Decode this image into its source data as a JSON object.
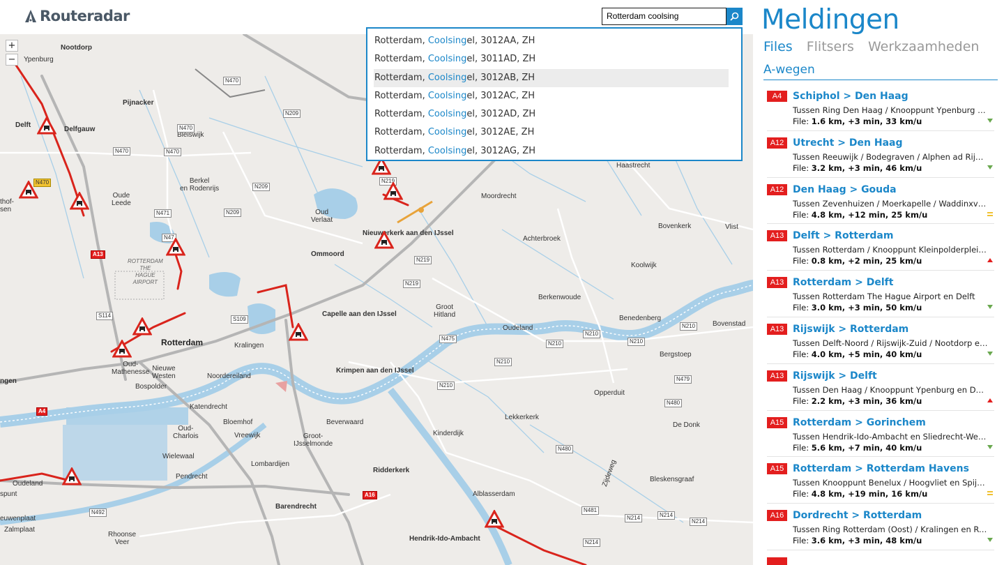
{
  "app": {
    "logo_text": "Routeradar"
  },
  "search": {
    "value": "Rotterdam coolsing",
    "button_icon": "search-icon"
  },
  "autocomplete": {
    "items": [
      {
        "prefix": "Rotterdam, ",
        "highlight": "Coolsing",
        "suffix": "el, 3012AA, ZH",
        "selected": false
      },
      {
        "prefix": "Rotterdam, ",
        "highlight": "Coolsing",
        "suffix": "el, 3011AD, ZH",
        "selected": false
      },
      {
        "prefix": "Rotterdam, ",
        "highlight": "Coolsing",
        "suffix": "el, 3012AB, ZH",
        "selected": true
      },
      {
        "prefix": "Rotterdam, ",
        "highlight": "Coolsing",
        "suffix": "el, 3012AC, ZH",
        "selected": false
      },
      {
        "prefix": "Rotterdam, ",
        "highlight": "Coolsing",
        "suffix": "el, 3012AD, ZH",
        "selected": false
      },
      {
        "prefix": "Rotterdam, ",
        "highlight": "Coolsing",
        "suffix": "el, 3012AE, ZH",
        "selected": false
      },
      {
        "prefix": "Rotterdam, ",
        "highlight": "Coolsing",
        "suffix": "el, 3012AG, ZH",
        "selected": false
      }
    ]
  },
  "map": {
    "zoom_in": "+",
    "zoom_out": "−",
    "labels": {
      "nootdorp": "Nootdorp",
      "ypenburg": "Ypenburg",
      "pijnacker": "Pijnacker",
      "delft": "Delft",
      "delfgauw": "Delfgauw",
      "bleiswijk": "Bleiswijk",
      "berkel": "Berkel\nen Rodenrijs",
      "oude_leede": "Oude\nLeede",
      "ommoord": "Ommoord",
      "nieuwerkerk": "Nieuwerkerk aan den IJssel",
      "oud_verlaat": "Oud\nVerlaat",
      "moordrecht": "Moordrecht",
      "achterbroek": "Achterbroek",
      "bovenkerk": "Bovenkerk",
      "vlist": "Vlist",
      "koolwijk": "Koolwijk",
      "berkenwoude": "Berkenwoude",
      "benedenberg": "Benedenberg",
      "bovenstad": "Bovenstad",
      "rotterdam_airport": "ROTTERDAM\nTHE\nHAGUE\nAIRPORT",
      "capelle": "Capelle aan den IJssel",
      "groot_hitland": "Groot\nHitland",
      "oudeland": "Oudeland",
      "bergstoep": "Bergstoep",
      "rotterdam": "Rotterdam",
      "kralingen": "Kralingen",
      "oud_mathenesse": "Oud-\nMathenesse",
      "nieuwe_westen": "Nieuwe\nWesten",
      "noordereiland": "Noordereiland",
      "bospolder": "Bospolder",
      "krimpen": "Krimpen aan den IJssel",
      "katendrecht": "Katendrecht",
      "opperduit": "Opperduit",
      "ngen": "ngen",
      "bloemhof": "Bloemhof",
      "oud_charlois": "Oud-\nCharlois",
      "vreewijk": "Vreewijk",
      "groot_ijsselmonde": "Groot-\nIJsselmonde",
      "beverwaard": "Beverwaard",
      "lekkerkerk": "Lekkerkerk",
      "de_donk": "De Donk",
      "kinderdijk": "Kinderdijk",
      "wielewaal": "Wielewaal",
      "lombardijen": "Lombardijen",
      "ridderkerk": "Ridderkerk",
      "pendrecht": "Pendrecht",
      "oudeland2": "Oudeland",
      "spunt": "spunt",
      "barendrecht": "Barendrecht",
      "alblasserdam": "Alblasserdam",
      "zijdeweg": "Zijdeweg",
      "bleskensgraaf": "Bleskensgraaf",
      "euwenplaat": "euwenplaat",
      "zalmplaat": "Zalmplaat",
      "rhoonse_veer": "Rhoonse\nVeer",
      "hendrik_ido": "Hendrik-Ido-Ambacht",
      "thof": "thof-\nsen",
      "haastrecht": "Haastrecht"
    },
    "shields": {
      "n470a": "N470",
      "n209a": "N209",
      "n470b": "N470",
      "n470c": "N470",
      "n470d": "N470",
      "n209b": "N209",
      "n471": "N471",
      "n209c": "N209",
      "n47": "N47",
      "n219a": "N219",
      "n219b": "N219",
      "n219c": "N219",
      "s114": "S114",
      "s109": "S109",
      "n475": "N475",
      "n210a": "N210",
      "n210b": "N210",
      "n210c": "N210",
      "n210d": "N210",
      "n210e": "N210",
      "n479": "N479",
      "n480a": "N480",
      "n480b": "N480",
      "n481": "N481",
      "n214a": "N214",
      "n214b": "N214",
      "n214c": "N214",
      "n214d": "N214",
      "n492": "N492",
      "a13": "A13",
      "a4": "A4",
      "a16": "A16",
      "n470y": "N470"
    }
  },
  "panel": {
    "title": "Meldingen",
    "tabs": [
      {
        "label": "Files",
        "active": true
      },
      {
        "label": "Flitsers",
        "active": false
      },
      {
        "label": "Werkzaamheden",
        "active": false
      }
    ],
    "section": "A-wegen",
    "incidents": [
      {
        "road": "A4",
        "route": "Schiphol > Den Haag",
        "desc": "Tussen Ring Den Haag / Knooppunt Ypenburg en Ri...",
        "file_label": "File: ",
        "file_value": "1.6 km, +3 min, 33 km/u",
        "trend": "down"
      },
      {
        "road": "A12",
        "route": "Utrecht > Den Haag",
        "desc": "Tussen Reeuwijk / Bodegraven / Alphen ad Rijn en...",
        "file_label": "File: ",
        "file_value": "3.2 km, +3 min, 46 km/u",
        "trend": "down"
      },
      {
        "road": "A12",
        "route": "Den Haag > Gouda",
        "desc": "Tussen Zevenhuizen / Moerkapelle / Waddinxveen...",
        "file_label": "File: ",
        "file_value": "4.8 km, +12 min, 25 km/u",
        "trend": "equal"
      },
      {
        "road": "A13",
        "route": "Delft > Rotterdam",
        "desc": "Tussen Rotterdam / Knooppunt Kleinpolderplein /...",
        "file_label": "File: ",
        "file_value": "0.8 km, +2 min, 25 km/u",
        "trend": "up"
      },
      {
        "road": "A13",
        "route": "Rotterdam > Delft",
        "desc": "Tussen Rotterdam The Hague Airport en Delft",
        "file_label": "File: ",
        "file_value": "3.0 km, +3 min, 50 km/u",
        "trend": "down"
      },
      {
        "road": "A13",
        "route": "Rijswijk > Rotterdam",
        "desc": "Tussen Delft-Noord / Rijswijk-Zuid / Nootdorp en R...",
        "file_label": "File: ",
        "file_value": "4.0 km, +5 min, 40 km/u",
        "trend": "down"
      },
      {
        "road": "A13",
        "route": "Rijswijk > Delft",
        "desc": "Tussen Den Haag / Knooppunt Ypenburg en Delft-...",
        "file_label": "File: ",
        "file_value": "2.2 km, +3 min, 36 km/u",
        "trend": "up"
      },
      {
        "road": "A15",
        "route": "Rotterdam > Gorinchem",
        "desc": "Tussen Hendrik-Ido-Ambacht en Sliedrecht-West /...",
        "file_label": "File: ",
        "file_value": "5.6 km, +7 min, 40 km/u",
        "trend": "down"
      },
      {
        "road": "A15",
        "route": "Rotterdam > Rotterdam Havens",
        "desc": "Tussen Knooppunt Benelux / Hoogvliet en Spijkenis...",
        "file_label": "File: ",
        "file_value": "4.8 km, +19 min, 16 km/u",
        "trend": "equal"
      },
      {
        "road": "A16",
        "route": "Dordrecht > Rotterdam",
        "desc": "Tussen Ring Rotterdam (Oost) / Kralingen en Rotter...",
        "file_label": "File: ",
        "file_value": "3.6 km, +3 min, 48 km/u",
        "trend": "down"
      }
    ]
  },
  "colors": {
    "accent": "#1b87c9",
    "road_badge": "#e31e1e",
    "trend_down": "#6aa84f",
    "trend_up": "#e31e1e",
    "trend_equal": "#f1c232",
    "water": "#a8cfe8",
    "map_bg": "#eeece9",
    "jam": "#d9241c"
  }
}
